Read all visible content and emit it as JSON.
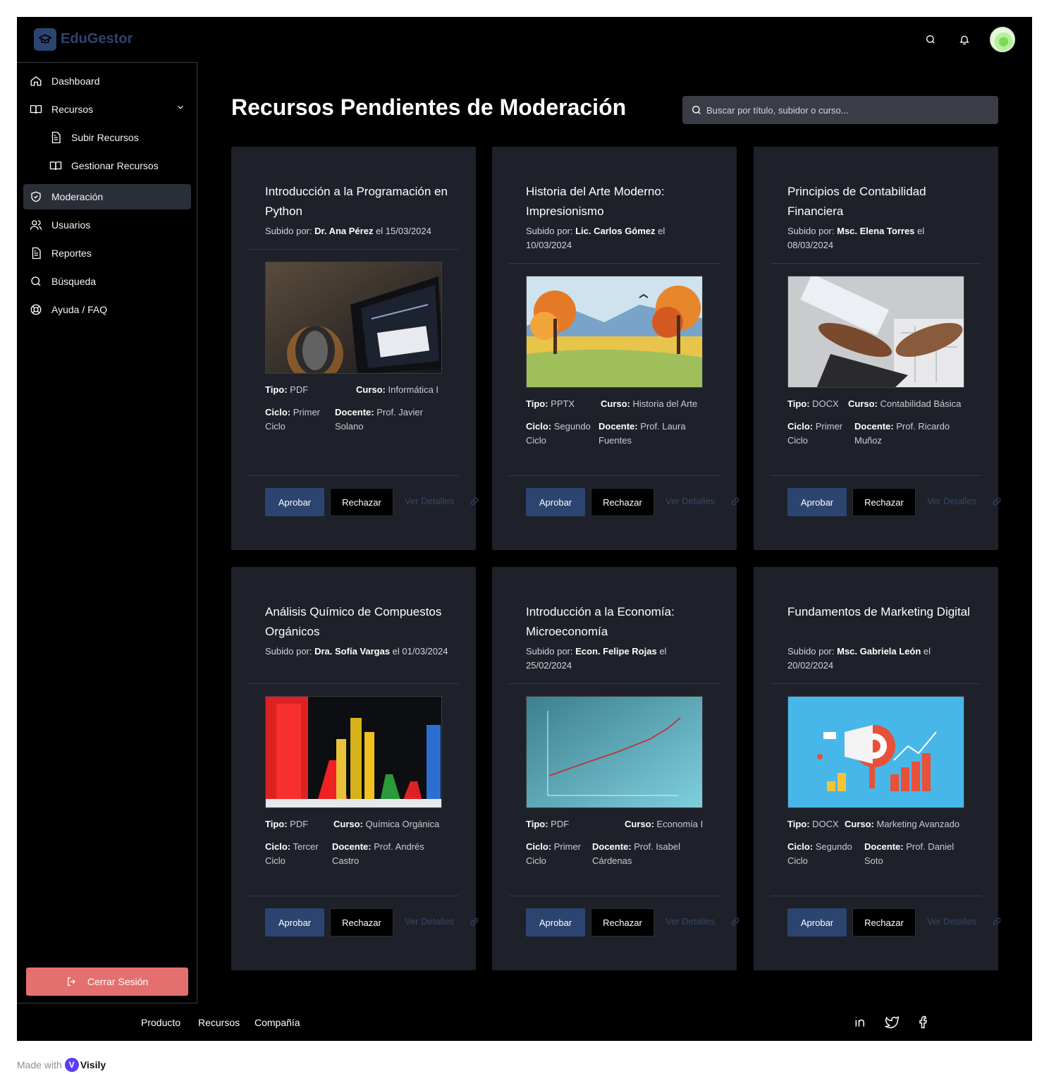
{
  "app": {
    "name": "EduGestor"
  },
  "header": {
    "search_icon": "search-icon",
    "bell_icon": "bell-icon"
  },
  "sidebar": {
    "items": [
      {
        "label": "Dashboard",
        "icon": "home-icon"
      },
      {
        "label": "Recursos",
        "icon": "book-icon"
      },
      {
        "label": "Subir Recursos",
        "icon": "file-icon"
      },
      {
        "label": "Gestionar Recursos",
        "icon": "book-icon"
      },
      {
        "label": "Moderación",
        "icon": "shield-icon"
      },
      {
        "label": "Usuarios",
        "icon": "users-icon"
      },
      {
        "label": "Reportes",
        "icon": "file-icon"
      },
      {
        "label": "Búsqueda",
        "icon": "search-icon"
      },
      {
        "label": "Ayuda / FAQ",
        "icon": "lifebuoy-icon"
      }
    ],
    "logout_label": "Cerrar Sesión"
  },
  "main": {
    "title": "Recursos Pendientes de Moderación",
    "search_placeholder": "Buscar por título, subidor o curso..."
  },
  "labels": {
    "uploaded_by": "Subido por:",
    "on": "el",
    "type": "Tipo:",
    "course": "Curso:",
    "cycle": "Ciclo:",
    "teacher": "Docente:",
    "approve": "Aprobar",
    "reject": "Rechazar",
    "details": "Ver Detalles"
  },
  "cards": [
    {
      "title": "Introducción a la Programación en Python",
      "uploader": "Dr. Ana Pérez",
      "date": "15/03/2024",
      "type": "PDF",
      "course": "Informática I",
      "cycle": "Primer Ciclo",
      "teacher": "Prof. Javier Solano",
      "image": "laptop-photo"
    },
    {
      "title": "Historia del Arte Moderno: Impresionismo",
      "uploader": "Lic. Carlos Gómez",
      "date": "10/03/2024",
      "type": "PPTX",
      "course": "Historia del Arte",
      "cycle": "Segundo Ciclo",
      "teacher": "Prof. Laura Fuentes",
      "image": "landscape-painting"
    },
    {
      "title": "Principios de Contabilidad Financiera",
      "uploader": "Msc. Elena Torres",
      "date": "08/03/2024",
      "type": "DOCX",
      "course": "Contabilidad Básica",
      "cycle": "Primer Ciclo",
      "teacher": "Prof. Ricardo Muñoz",
      "image": "calculator-photo"
    },
    {
      "title": "Análisis Químico de Compuestos Orgánicos",
      "uploader": "Dra. Sofía Vargas",
      "date": "01/03/2024",
      "type": "PDF",
      "course": "Química Orgánica",
      "cycle": "Tercer Ciclo",
      "teacher": "Prof. Andrés Castro",
      "image": "lab-flasks"
    },
    {
      "title": "Introducción a la Economía: Microeconomía",
      "uploader": "Econ. Felipe Rojas",
      "date": "25/02/2024",
      "type": "PDF",
      "course": "Economía I",
      "cycle": "Primer Ciclo",
      "teacher": "Prof. Isabel Cárdenas",
      "image": "line-graph"
    },
    {
      "title": "Fundamentos de Marketing Digital",
      "uploader": "Msc. Gabriela León",
      "date": "20/02/2024",
      "type": "DOCX",
      "course": "Marketing Avanzado",
      "cycle": "Segundo Ciclo",
      "teacher": "Prof. Daniel Soto",
      "image": "megaphone-illustration"
    }
  ],
  "footer": {
    "links": [
      "Producto",
      "Recursos",
      "Compañía"
    ],
    "social": [
      "linkedin-icon",
      "twitter-icon",
      "facebook-icon"
    ]
  },
  "watermark": {
    "made_with": "Made with",
    "brand": "Visily"
  },
  "colors": {
    "accent": "#2c4470",
    "logout": "#e46f6f",
    "card": "#1e2129",
    "background": "#000000"
  }
}
